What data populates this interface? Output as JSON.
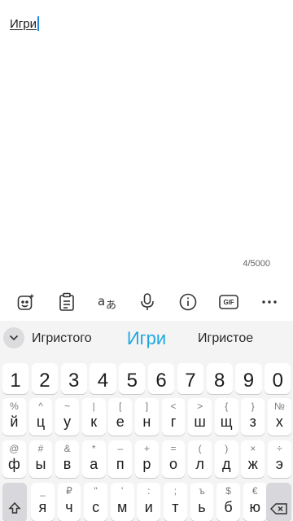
{
  "editor": {
    "typed_text": "Игри",
    "counter": "4/5000"
  },
  "toolbar": {
    "items": [
      "sticker-icon",
      "clipboard-icon",
      "translate-icon",
      "microphone-icon",
      "info-icon",
      "gif-icon",
      "more-icon"
    ],
    "gif_label": "GIF"
  },
  "suggestions": {
    "left": "Игристого",
    "center": "Игри",
    "right": "Игристое"
  },
  "keyboard": {
    "numbers": [
      "1",
      "2",
      "3",
      "4",
      "5",
      "6",
      "7",
      "8",
      "9",
      "0"
    ],
    "row1": [
      {
        "main": "й",
        "hint": "%"
      },
      {
        "main": "ц",
        "hint": "^"
      },
      {
        "main": "у",
        "hint": "~"
      },
      {
        "main": "к",
        "hint": "|"
      },
      {
        "main": "е",
        "hint": "["
      },
      {
        "main": "н",
        "hint": "]"
      },
      {
        "main": "г",
        "hint": "<"
      },
      {
        "main": "ш",
        "hint": ">"
      },
      {
        "main": "щ",
        "hint": "{"
      },
      {
        "main": "з",
        "hint": "}"
      },
      {
        "main": "х",
        "hint": "№"
      }
    ],
    "row2": [
      {
        "main": "ф",
        "hint": "@"
      },
      {
        "main": "ы",
        "hint": "#"
      },
      {
        "main": "в",
        "hint": "&"
      },
      {
        "main": "а",
        "hint": "*"
      },
      {
        "main": "п",
        "hint": "–"
      },
      {
        "main": "р",
        "hint": "+"
      },
      {
        "main": "о",
        "hint": "="
      },
      {
        "main": "л",
        "hint": "("
      },
      {
        "main": "д",
        "hint": ")"
      },
      {
        "main": "ж",
        "hint": "×"
      },
      {
        "main": "э",
        "hint": "÷"
      }
    ],
    "row3": [
      {
        "main": "я",
        "hint": "_"
      },
      {
        "main": "ч",
        "hint": "₽"
      },
      {
        "main": "с",
        "hint": "\""
      },
      {
        "main": "м",
        "hint": "'"
      },
      {
        "main": "и",
        "hint": ":"
      },
      {
        "main": "т",
        "hint": ";"
      },
      {
        "main": "ь",
        "hint": "ъ"
      },
      {
        "main": "б",
        "hint": "$"
      },
      {
        "main": "ю",
        "hint": "€"
      }
    ]
  }
}
